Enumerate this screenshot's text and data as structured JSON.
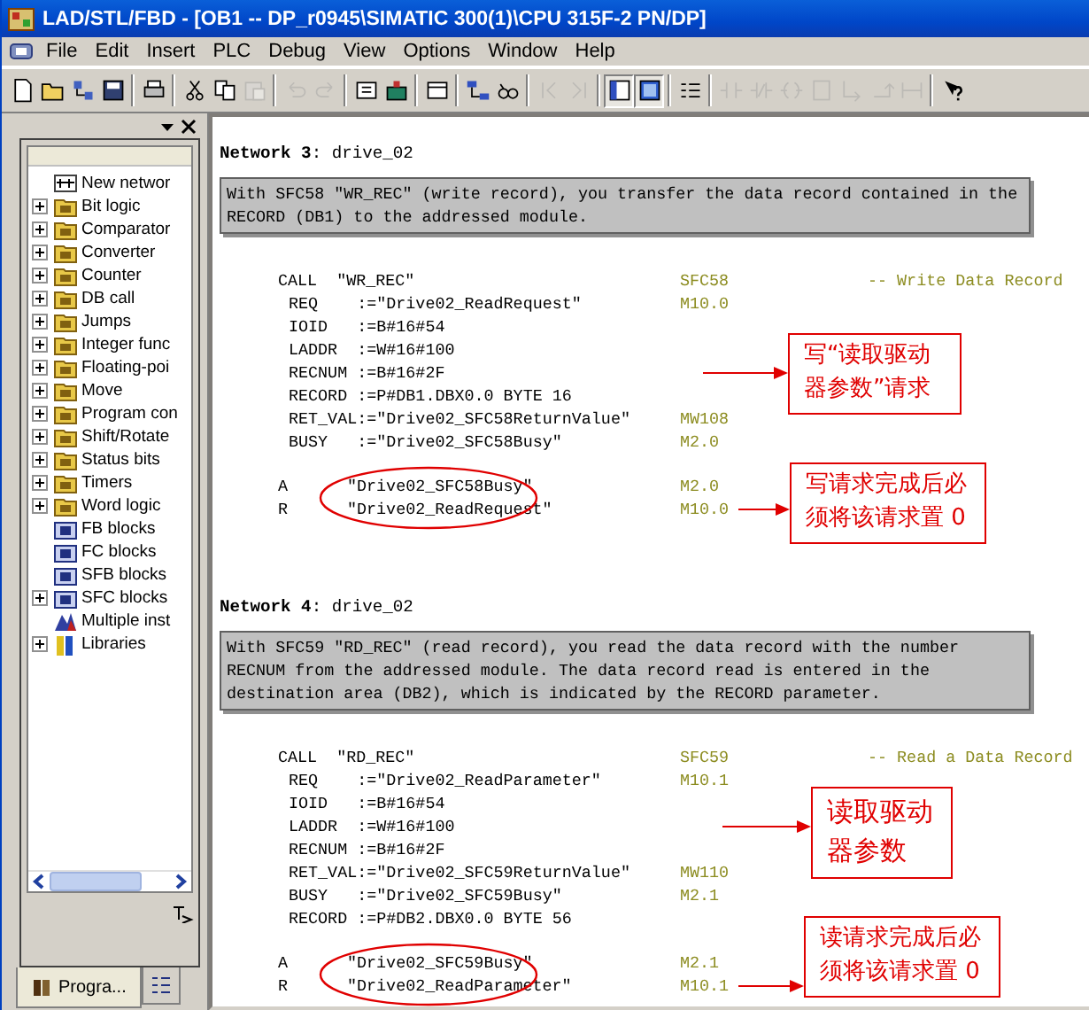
{
  "window": {
    "title": "LAD/STL/FBD  - [OB1 -- DP_r0945\\SIMATIC 300(1)\\CPU 315F-2 PN/DP]"
  },
  "menu": [
    "File",
    "Edit",
    "Insert",
    "PLC",
    "Debug",
    "View",
    "Options",
    "Window",
    "Help"
  ],
  "toolbar": [
    {
      "disabled": false,
      "pressed": false
    },
    {
      "disabled": false,
      "pressed": false
    },
    {
      "disabled": false,
      "pressed": false
    },
    {
      "disabled": false,
      "pressed": false
    },
    {
      "disabled": false,
      "pressed": false
    },
    {
      "disabled": false,
      "pressed": false
    },
    {
      "disabled": false,
      "pressed": false
    },
    {
      "disabled": true,
      "pressed": false
    },
    {
      "disabled": true,
      "pressed": false
    },
    {
      "disabled": true,
      "pressed": false
    },
    {
      "disabled": false,
      "pressed": false
    },
    {
      "disabled": false,
      "pressed": false
    },
    {
      "disabled": false,
      "pressed": false
    },
    {
      "disabled": false,
      "pressed": false
    },
    {
      "disabled": false,
      "pressed": false
    },
    {
      "disabled": true,
      "pressed": false
    },
    {
      "disabled": true,
      "pressed": false
    },
    {
      "disabled": false,
      "pressed": true
    },
    {
      "disabled": false,
      "pressed": true
    },
    {
      "disabled": false,
      "pressed": false
    },
    {
      "disabled": true,
      "pressed": false
    },
    {
      "disabled": true,
      "pressed": false
    },
    {
      "disabled": true,
      "pressed": false
    },
    {
      "disabled": true,
      "pressed": false
    },
    {
      "disabled": true,
      "pressed": false
    },
    {
      "disabled": true,
      "pressed": false
    },
    {
      "disabled": true,
      "pressed": false
    },
    {
      "disabled": false,
      "pressed": false
    }
  ],
  "catalog": {
    "items": [
      {
        "label": "New networ",
        "kind": "network",
        "expandable": false
      },
      {
        "label": "Bit logic",
        "kind": "folder",
        "expandable": true
      },
      {
        "label": "Comparator",
        "kind": "folder",
        "expandable": true
      },
      {
        "label": "Converter",
        "kind": "folder",
        "expandable": true
      },
      {
        "label": "Counter",
        "kind": "folder",
        "expandable": true
      },
      {
        "label": "DB call",
        "kind": "folder",
        "expandable": true
      },
      {
        "label": "Jumps",
        "kind": "folder",
        "expandable": true
      },
      {
        "label": "Integer func",
        "kind": "folder",
        "expandable": true
      },
      {
        "label": "Floating-poi",
        "kind": "folder",
        "expandable": true
      },
      {
        "label": "Move",
        "kind": "folder",
        "expandable": true
      },
      {
        "label": "Program con",
        "kind": "folder",
        "expandable": true
      },
      {
        "label": "Shift/Rotate",
        "kind": "folder",
        "expandable": true
      },
      {
        "label": "Status bits",
        "kind": "folder",
        "expandable": true
      },
      {
        "label": "Timers",
        "kind": "folder",
        "expandable": true
      },
      {
        "label": "Word logic",
        "kind": "folder",
        "expandable": true
      },
      {
        "label": "FB blocks",
        "kind": "block",
        "expandable": false
      },
      {
        "label": "FC blocks",
        "kind": "block",
        "expandable": false
      },
      {
        "label": "SFB blocks",
        "kind": "block",
        "expandable": false
      },
      {
        "label": "SFC blocks",
        "kind": "block",
        "expandable": true
      },
      {
        "label": "Multiple inst",
        "kind": "multi",
        "expandable": false
      },
      {
        "label": "Libraries",
        "kind": "library",
        "expandable": true
      }
    ],
    "tabs": [
      {
        "label": "Progra...",
        "selected": true
      },
      {
        "selected": false
      }
    ]
  },
  "networks": [
    {
      "title": "**Network 3**: drive_02",
      "comment": "With SFC58 \"WR_REC\" (write record), you transfer the data record contained in the RECORD (DB1) to the addressed module.",
      "lines": [
        {
          "kind": "call",
          "code": "CALL  \"WR_REC\"",
          "address": "SFC58",
          "comment": "-- Write Data Record"
        },
        {
          "kind": "param",
          "name": "REQ",
          "value": ":=\"Drive02_ReadRequest\"",
          "address": "M10.0"
        },
        {
          "kind": "param",
          "name": "IOID",
          "value": ":=B#16#54"
        },
        {
          "kind": "param",
          "name": "LADDR",
          "value": ":=W#16#100"
        },
        {
          "kind": "param",
          "name": "RECNUM",
          "value": ":=B#16#2F",
          "note": "写“读取驱动器参数”请求"
        },
        {
          "kind": "param",
          "name": "RECORD",
          "value": ":=P#DB1.DBX0.0 BYTE 16"
        },
        {
          "kind": "param",
          "name": "RET_VAL",
          "value": ":=\"Drive02_SFC58ReturnValue\"",
          "address": "MW108"
        },
        {
          "kind": "param",
          "name": "BUSY",
          "value": ":=\"Drive02_SFC58Busy\"",
          "address": "M2.0"
        }
      ],
      "logic": {
        "circled": true,
        "lines": [
          {
            "op": "A",
            "operand": "\"Drive02_SFC58Busy\"",
            "address": "M2.0"
          },
          {
            "op": "R",
            "operand": "\"Drive02_ReadRequest\"",
            "address": "M10.0",
            "note": "写请求完成后必须将该请求置 0"
          }
        ]
      }
    },
    {
      "title": "**Network 4**: drive_02",
      "comment": "With SFC59 \"RD_REC\" (read record), you read the data record with the number RECNUM from the addressed module. The data record read is entered in the destination area (DB2), which is indicated by the RECORD parameter.",
      "lines": [
        {
          "kind": "call",
          "code": "CALL  \"RD_REC\"",
          "address": "SFC59",
          "comment": "-- Read a Data Record"
        },
        {
          "kind": "param",
          "name": "REQ",
          "value": ":=\"Drive02_ReadParameter\"",
          "address": "M10.1"
        },
        {
          "kind": "param",
          "name": "IOID",
          "value": ":=B#16#54"
        },
        {
          "kind": "param",
          "name": "LADDR",
          "value": ":=W#16#100",
          "note": "读取驱动器参数"
        },
        {
          "kind": "param",
          "name": "RECNUM",
          "value": ":=B#16#2F"
        },
        {
          "kind": "param",
          "name": "RET_VAL",
          "value": ":=\"Drive02_SFC59ReturnValue\"",
          "address": "MW110"
        },
        {
          "kind": "param",
          "name": "BUSY",
          "value": ":=\"Drive02_SFC59Busy\"",
          "address": "M2.1"
        },
        {
          "kind": "param",
          "name": "RECORD",
          "value": ":=P#DB2.DBX0.0 BYTE 56"
        }
      ],
      "logic": {
        "circled": true,
        "lines": [
          {
            "op": "A",
            "operand": "\"Drive02_SFC59Busy\"",
            "address": "M2.1"
          },
          {
            "op": "R",
            "operand": "\"Drive02_ReadParameter\"",
            "address": "M10.1",
            "note": "读请求完成后必须将该请求置 0"
          }
        ]
      }
    }
  ]
}
